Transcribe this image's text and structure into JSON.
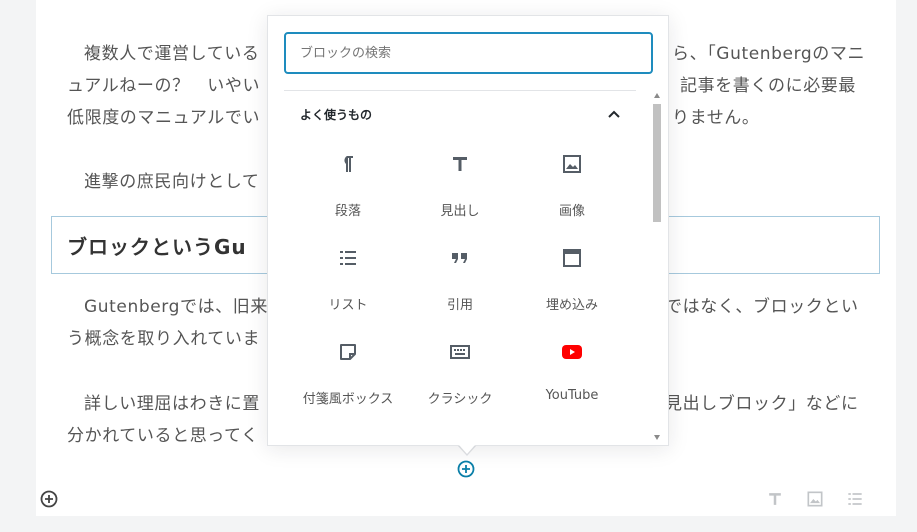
{
  "content": {
    "p1_line1_left": "複数人で運営している",
    "p1_line1_right": "ら、「Gutenbergのマニ",
    "p1_line2_left": "ュアルねーの？　いやい",
    "p1_line2_right": "記事を書くのに必要最",
    "p1_line3_left": "低限度のマニュアルでい",
    "p1_line3_right": "りません。",
    "p2_line1": "進撃の庶民向けとして",
    "heading": "ブロックというGu",
    "p3_line1_left": "Gutenbergでは、旧来",
    "p3_line1_right": "ではなく、ブロックとい",
    "p3_line2_left": "う概念を取り入れていま",
    "p4_line1_left": "詳しい理屈はわきに置",
    "p4_line1_right": "見出しブロック」などに",
    "p4_line2_left": "分かれていると思ってく"
  },
  "inserter": {
    "search_placeholder": "ブロックの検索",
    "section_title": "よく使うもの",
    "blocks": [
      {
        "label": "段落",
        "icon": "paragraph-icon"
      },
      {
        "label": "見出し",
        "icon": "heading-icon"
      },
      {
        "label": "画像",
        "icon": "image-icon"
      },
      {
        "label": "リスト",
        "icon": "list-icon"
      },
      {
        "label": "引用",
        "icon": "quote-icon"
      },
      {
        "label": "埋め込み",
        "icon": "embed-icon"
      },
      {
        "label": "付箋風ボックス",
        "icon": "sticky-note-icon"
      },
      {
        "label": "クラシック",
        "icon": "keyboard-icon"
      },
      {
        "label": "YouTube",
        "icon": "youtube-icon"
      }
    ]
  },
  "colors": {
    "accent": "#1e8cbe",
    "add_button": "#0a7fa8",
    "youtube": "#ff0000",
    "icon": "#555d66"
  }
}
